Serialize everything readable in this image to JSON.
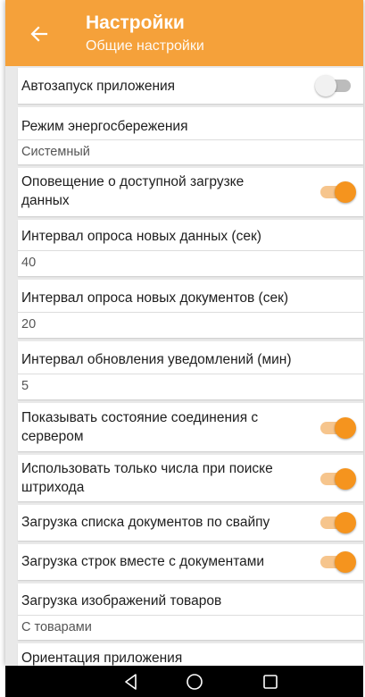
{
  "appbar": {
    "title": "Настройки",
    "subtitle": "Общие настройки",
    "back_icon": "arrow-left-icon",
    "color": "#f5a13a"
  },
  "settings": {
    "autostart": {
      "label": "Автозапуск приложения",
      "enabled": false
    },
    "power_mode": {
      "label": "Режим энергосбережения",
      "value": "Системный"
    },
    "download_notify": {
      "label": "Оповещение о доступной загрузке\nданных",
      "enabled": true
    },
    "poll_data": {
      "label": "Интервал опроса новых данных (сек)",
      "value": "40"
    },
    "poll_docs": {
      "label": "Интервал опроса новых документов (сек)",
      "value": "20"
    },
    "notify_interval": {
      "label": "Интервал обновления уведомлений (мин)",
      "value": "5"
    },
    "show_connection": {
      "label": "Показывать состояние соединения с\nсервером",
      "enabled": true
    },
    "numbers_only": {
      "label": "Использовать только числа при поиске\nштрихода",
      "enabled": true
    },
    "swipe_load": {
      "label": "Загрузка списка документов по свайпу",
      "enabled": true
    },
    "rows_with_docs": {
      "label": "Загрузка строк вместе с документами",
      "enabled": true
    },
    "images_load": {
      "label": "Загрузка изображений товаров",
      "value": "С товарами"
    },
    "orientation": {
      "label": "Ориентация приложения"
    }
  },
  "navbar": {
    "back_icon": "triangle-back-icon",
    "home_icon": "circle-home-icon",
    "recents_icon": "square-recents-icon"
  },
  "colors": {
    "accent": "#f5941e",
    "accent_track": "#f6c58d",
    "background": "#e9e9e9"
  }
}
